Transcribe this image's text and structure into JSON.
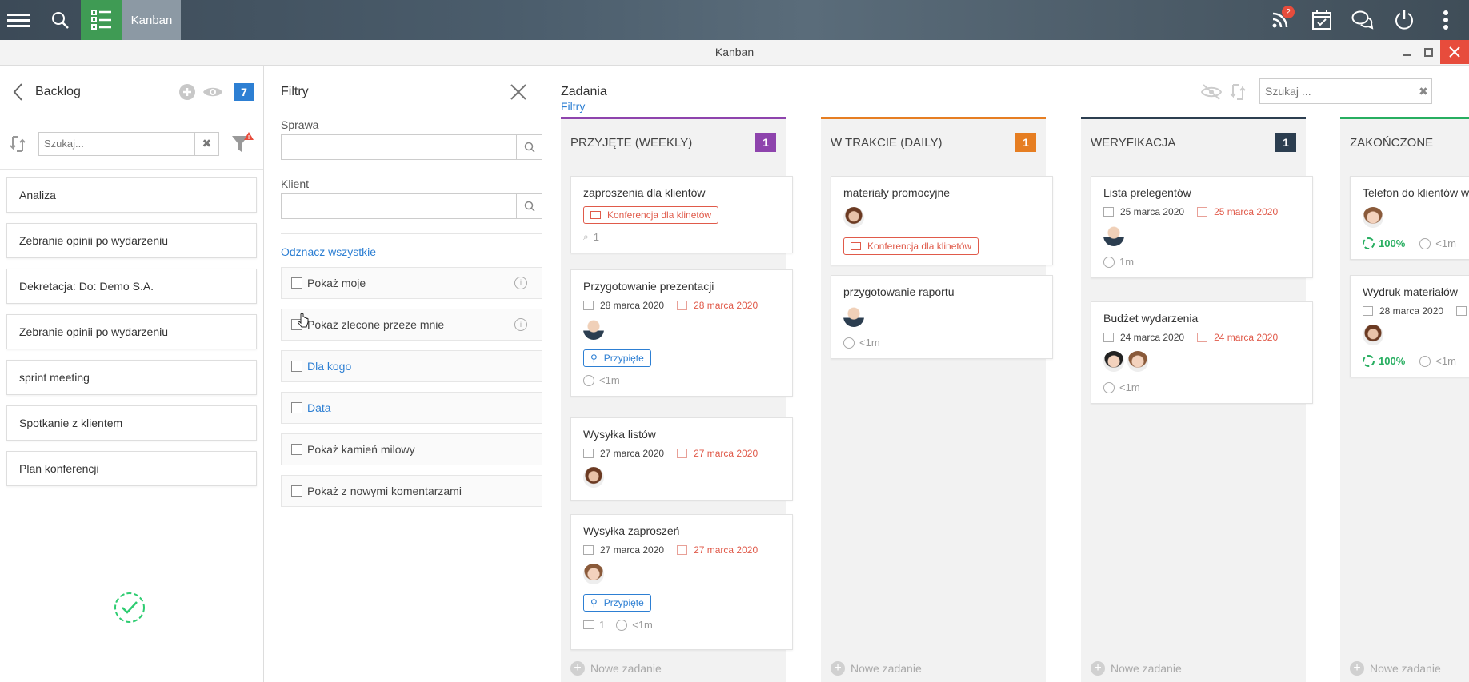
{
  "topbar": {
    "app_title": "Kanban",
    "notif_count": "2"
  },
  "window": {
    "title": "Kanban"
  },
  "backlog": {
    "title": "Backlog",
    "count": "7",
    "search_placeholder": "Szukaj...",
    "items": [
      {
        "label": "Analiza"
      },
      {
        "label": "Zebranie opinii po wydarzeniu"
      },
      {
        "label": "Dekretacja: Do: Demo S.A."
      },
      {
        "label": "Zebranie opinii po wydarzeniu"
      },
      {
        "label": "sprint meeting"
      },
      {
        "label": "Spotkanie z klientem"
      },
      {
        "label": "Plan konferencji"
      }
    ]
  },
  "filters": {
    "title": "Filtry",
    "sprawa_label": "Sprawa",
    "klient_label": "Klient",
    "select_all": "Odznacz wszystkie",
    "options": [
      {
        "label": "Pokaż moje"
      },
      {
        "label": "Pokaż zlecone przeze mnie"
      },
      {
        "label": "Dla kogo"
      },
      {
        "label": "Data"
      },
      {
        "label": "Pokaż kamień milowy"
      },
      {
        "label": "Pokaż z nowymi komentarzami"
      }
    ]
  },
  "board": {
    "title": "Zadania",
    "filters_link": "Filtry",
    "search_placeholder": "Szukaj ...",
    "new_task": "Nowe zadanie",
    "columns": [
      {
        "name": "PRZYJĘTE (WEEKLY)",
        "count": "1",
        "color": "#8e44ad",
        "cards": [
          {
            "title": "zaproszenia dla klientów",
            "tag": "Konferencja dla klinetów",
            "attachments": "1"
          },
          {
            "title": "Przygotowanie prezentacji",
            "date_start": "28 marca 2020",
            "date_end": "28 marca 2020",
            "tag": "Przypięte",
            "time": "<1m"
          },
          {
            "title": "Wysyłka listów",
            "date_start": "27 marca 2020",
            "date_end": "27 marca 2020"
          },
          {
            "title": "Wysyłka zaproszeń",
            "date_start": "27 marca 2020",
            "date_end": "27 marca 2020",
            "tag": "Przypięte",
            "comments": "1",
            "time": "<1m"
          }
        ]
      },
      {
        "name": "W TRAKCIE (DAILY)",
        "count": "1",
        "color": "#e67e22",
        "cards": [
          {
            "title": "materiały promocyjne",
            "tag": "Konferencja dla klinetów"
          },
          {
            "title": "przygotowanie raportu",
            "time": "<1m"
          }
        ]
      },
      {
        "name": "WERYFIKACJA",
        "count": "1",
        "color": "#2c3e50",
        "cards": [
          {
            "title": "Lista prelegentów",
            "date_start": "25 marca 2020",
            "date_end": "25 marca 2020",
            "time": "1m"
          },
          {
            "title": "Budżet wydarzenia",
            "date_start": "24 marca 2020",
            "date_end": "24 marca 2020",
            "time": "<1m"
          }
        ]
      },
      {
        "name": "ZAKOŃCZONE",
        "color": "#27ae60",
        "cards": [
          {
            "title": "Telefon do klientów w",
            "progress": "100%",
            "time": "<1m"
          },
          {
            "title": "Wydruk materiałów",
            "date_start": "28 marca 2020",
            "progress": "100%",
            "time": "<1m"
          }
        ]
      }
    ]
  }
}
